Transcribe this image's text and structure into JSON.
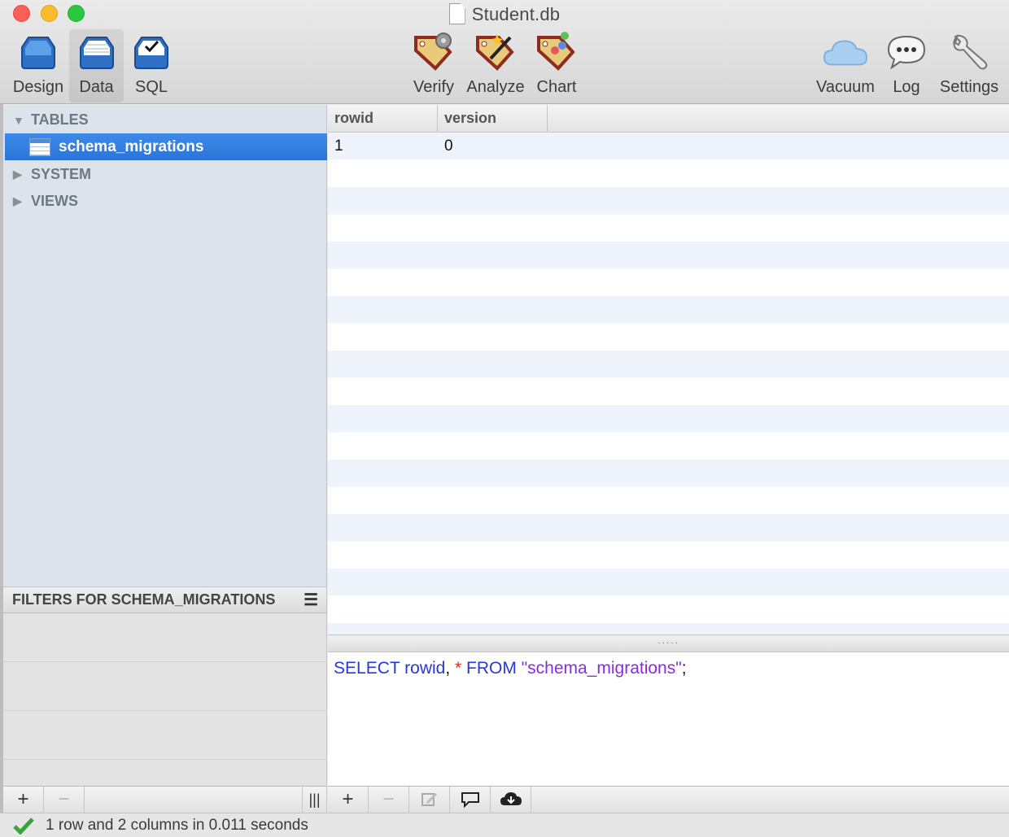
{
  "window": {
    "title": "Student.db"
  },
  "toolbar": {
    "design_label": "Design",
    "data_label": "Data",
    "sql_label": "SQL",
    "verify_label": "Verify",
    "analyze_label": "Analyze",
    "chart_label": "Chart",
    "vacuum_label": "Vacuum",
    "log_label": "Log",
    "settings_label": "Settings"
  },
  "sidebar": {
    "groups": [
      {
        "label": "TABLES",
        "expanded": true
      },
      {
        "label": "SYSTEM",
        "expanded": false
      },
      {
        "label": "VIEWS",
        "expanded": false
      }
    ],
    "selected_table": "schema_migrations"
  },
  "filters": {
    "title": "FILTERS FOR SCHEMA_MIGRATIONS"
  },
  "grid": {
    "columns": [
      "rowid",
      "version"
    ],
    "rows": [
      [
        "1",
        "0"
      ]
    ]
  },
  "editor": {
    "tokens": [
      {
        "text": "SELECT rowid",
        "kind": "kw"
      },
      {
        "text": ", ",
        "kind": "punct"
      },
      {
        "text": "*",
        "kind": "star"
      },
      {
        "text": " FROM ",
        "kind": "kw"
      },
      {
        "text": "\"schema_migrations\"",
        "kind": "str"
      },
      {
        "text": ";",
        "kind": "punct"
      }
    ]
  },
  "footer": {
    "add": "+",
    "remove": "−",
    "columns": "|||"
  },
  "status": {
    "text": "1 row and 2 columns in 0.011 seconds"
  },
  "colors": {
    "selection": "#2f7ade",
    "sql_keyword": "#2a38d6",
    "sql_string": "#8a2be2",
    "sql_star": "#e0281c"
  }
}
